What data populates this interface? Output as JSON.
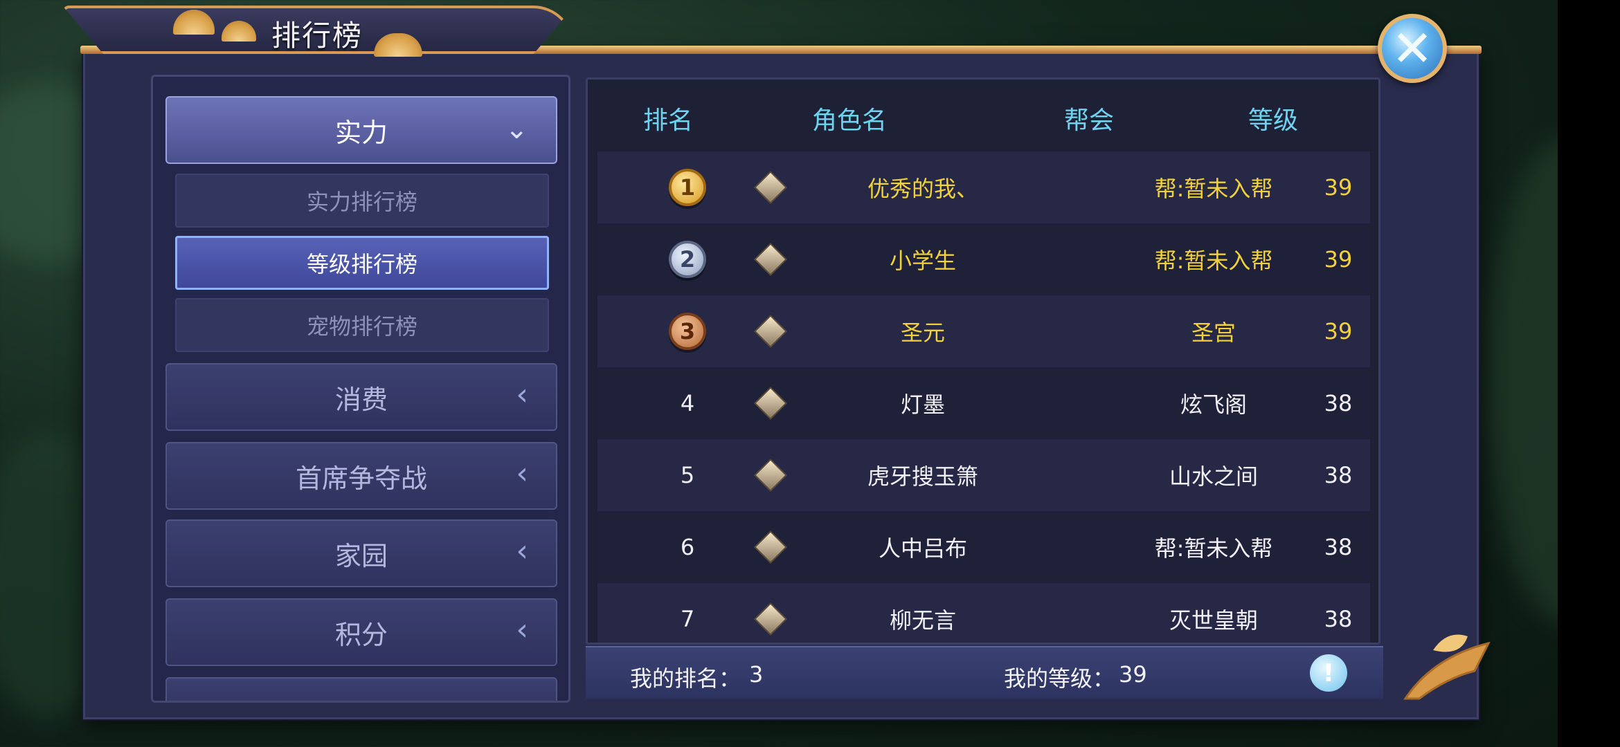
{
  "header": {
    "title": "排行榜"
  },
  "left_panel": {
    "categories": [
      {
        "label": "实力",
        "expanded": true
      },
      {
        "label": "消费",
        "expanded": false
      },
      {
        "label": "首席争夺战",
        "expanded": false
      },
      {
        "label": "家园",
        "expanded": false
      },
      {
        "label": "积分",
        "expanded": false
      }
    ],
    "subitems": [
      {
        "label": "实力排行榜",
        "selected": false
      },
      {
        "label": "等级排行榜",
        "selected": true
      },
      {
        "label": "宠物排行榜",
        "selected": false
      }
    ]
  },
  "table": {
    "headers": {
      "rank": "排名",
      "name": "角色名",
      "guild": "帮会",
      "level": "等级"
    },
    "rows": [
      {
        "rank": "1",
        "name": "优秀的我、",
        "guild": "帮:暂未入帮",
        "level": "39"
      },
      {
        "rank": "2",
        "name": "小学生",
        "guild": "帮:暂未入帮",
        "level": "39"
      },
      {
        "rank": "3",
        "name": "圣元",
        "guild": "圣宫",
        "level": "39"
      },
      {
        "rank": "4",
        "name": "灯墨",
        "guild": "炫飞阁",
        "level": "38"
      },
      {
        "rank": "5",
        "name": "虎牙搜玉箫",
        "guild": "山水之间",
        "level": "38"
      },
      {
        "rank": "6",
        "name": "人中吕布",
        "guild": "帮:暂未入帮",
        "level": "38"
      },
      {
        "rank": "7",
        "name": "柳无言",
        "guild": "灭世皇朝",
        "level": "38"
      }
    ]
  },
  "footer": {
    "my_rank_label": "我的排名：",
    "my_rank": "3",
    "my_level_label": "我的等级：",
    "my_level": "39",
    "info_icon": "info-icon"
  },
  "colors": {
    "header_text": "#6fd3f0",
    "top_three_text": "#f2d23a",
    "normal_text": "#f0f0f5",
    "panel_bg": "#2a2c4e",
    "accent_gold": "#d79b55"
  }
}
